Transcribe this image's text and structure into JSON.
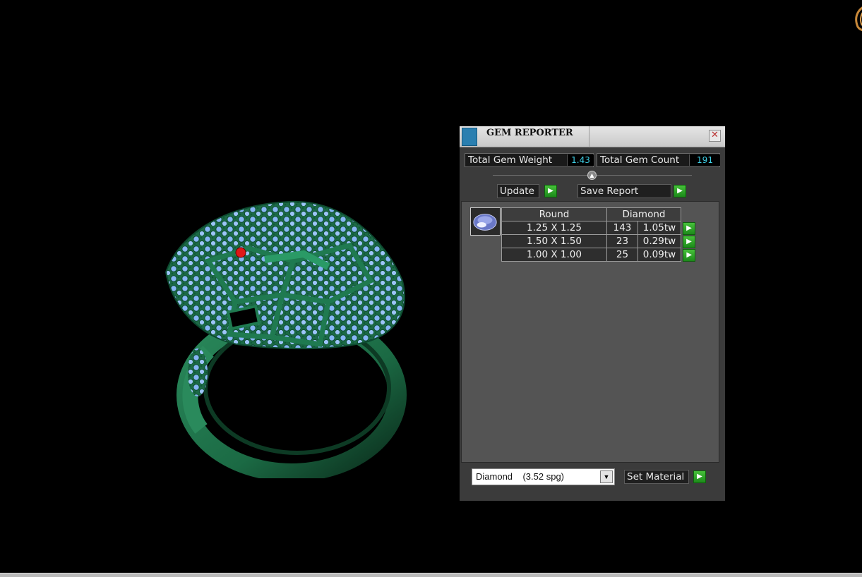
{
  "panel": {
    "title": "GEM REPORTER",
    "close_symbol": "✕",
    "total_gem_weight_label": "Total Gem Weight",
    "total_gem_weight_value": "1.43",
    "total_gem_count_label": "Total Gem Count",
    "total_gem_count_value": "191",
    "update_label": "Update",
    "save_report_label": "Save Report",
    "play_symbol": "▶",
    "collapse_symbol": "▲",
    "table": {
      "headers": [
        "Round",
        "Diamond"
      ],
      "rows": [
        {
          "size": "1.25 X 1.25",
          "count": "143",
          "weight": "1.05tw"
        },
        {
          "size": "1.50 X 1.50",
          "count": "23",
          "weight": "0.29tw"
        },
        {
          "size": "1.00 X 1.00",
          "count": "25",
          "weight": "0.09tw"
        }
      ]
    },
    "material_select_value": "Diamond    (3.52 spg)",
    "dropdown_symbol": "▼",
    "set_material_label": "Set Material"
  },
  "colors": {
    "metal": "#1f6e49",
    "gems": "#7fb0f0",
    "eye": "#d01010",
    "accent_green": "#2fa52a",
    "value_cyan": "#3fd0e6"
  },
  "icons": [
    "gem-reporter-app-icon",
    "close-icon",
    "play-icon",
    "collapse-arrow-icon",
    "diamond-gem-icon",
    "dropdown-arrow-icon",
    "logo-icon"
  ]
}
